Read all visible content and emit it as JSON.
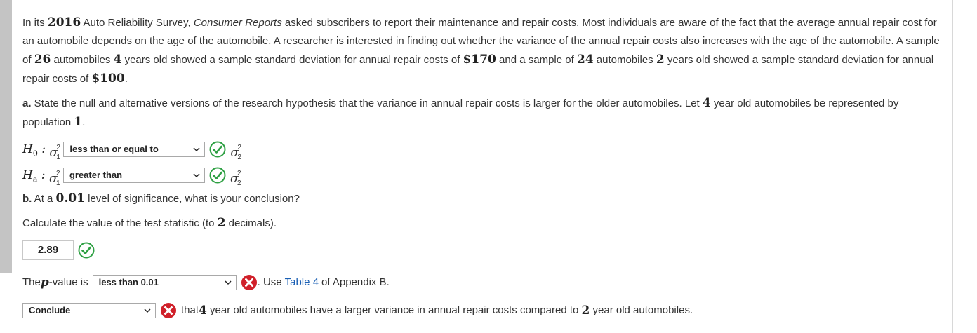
{
  "problem": {
    "intro": {
      "t1": "In its ",
      "year": "2016",
      "t2": " Auto Reliability Survey, ",
      "source": "Consumer Reports",
      "t3": " asked subscribers to report their maintenance and repair costs. Most individuals are aware of the fact that the average annual repair cost for an automobile depends on the age of the automobile. A researcher is interested in finding out whether the variance of the annual repair costs also increases with the age of the automobile. A sample of ",
      "n1": "26",
      "t4": " automobiles ",
      "age1": "4",
      "t5": " years old showed a sample standard deviation for annual repair costs of ",
      "sd1": "$170",
      "t6": " and a sample of ",
      "n2": "24",
      "t7": " automobiles ",
      "age2": "2",
      "t8": " years old showed a sample standard deviation for annual repair costs of ",
      "sd2": "$100",
      "t9": "."
    }
  },
  "part_a": {
    "label": "a.",
    "t1": " State the null and alternative versions of the research hypothesis that the variance in annual repair costs is larger for the older automobiles. Let ",
    "age": "4",
    "t2": " year old automobiles be represented by population ",
    "pop": "1",
    "t3": ".",
    "h0": {
      "sym": "H",
      "sub": "0",
      "select_value": "less than or equal to",
      "status": "correct"
    },
    "ha": {
      "sym": "H",
      "sub": "a",
      "select_value": "greater than",
      "status": "correct"
    }
  },
  "part_b": {
    "label": "b.",
    "t1": " At a ",
    "alpha": "0.01",
    "t2": " level of significance, what is your conclusion?",
    "calc_t1": "Calculate the value of the test statistic (to ",
    "decimals": "2",
    "calc_t2": " decimals).",
    "test_statistic": "2.89",
    "test_statistic_status": "correct",
    "pvalue_t1": "The ",
    "pvalue_p": "p",
    "pvalue_t2": "-value is",
    "pvalue_select": "less than 0.01",
    "pvalue_status": "incorrect",
    "use_t1": ". Use ",
    "table_link": "Table 4",
    "use_t2": " of Appendix B.",
    "conclusion_select": "Conclude",
    "conclusion_status": "incorrect",
    "concl_t1": "that ",
    "concl_age1": "4",
    "concl_t2": " year old automobiles have a larger variance in annual repair costs compared to ",
    "concl_age2": "2",
    "concl_t3": " year old automobiles."
  },
  "colors": {
    "correct": "#2ea043",
    "incorrect": "#d0202a",
    "link": "#1a5fb4"
  }
}
